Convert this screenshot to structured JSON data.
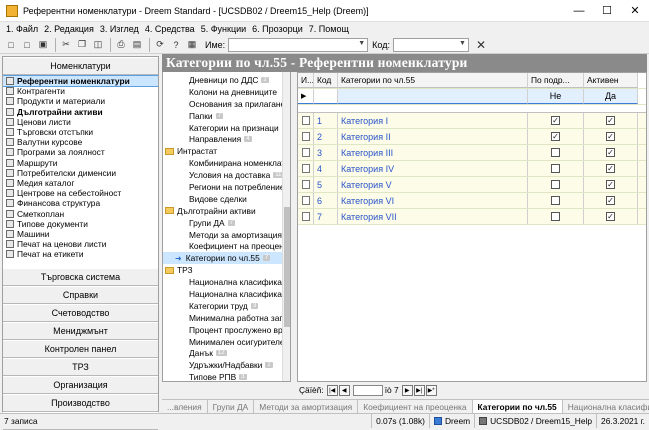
{
  "window": {
    "title": "Референтни номенклатури - Dreem Standard - [UCSDB02 / Dreem15_Help (Dreem)]"
  },
  "menu": [
    "1. Файл",
    "2. Редакция",
    "3. Изглед",
    "4. Средства",
    "5. Функции",
    "6. Прозорци",
    "7. Помощ"
  ],
  "toolbar": {
    "name_label": "Име:",
    "code_label": "Код:",
    "name_value": "",
    "code_value": ""
  },
  "left_nav": {
    "top_button": "Номенклатури",
    "items": [
      {
        "label": "Референтни номенклатури",
        "selected": true,
        "bold": true
      },
      {
        "label": "Контрагенти"
      },
      {
        "label": "Продукти и материали"
      },
      {
        "label": "Дълготрайни активи",
        "bold": true
      },
      {
        "label": "Ценови листи"
      },
      {
        "label": "Търговски отстъпки"
      },
      {
        "label": "Валутни курсове"
      },
      {
        "label": "Програми за лоялност"
      },
      {
        "label": "Маршрути"
      },
      {
        "label": "Потребителски дименсии"
      },
      {
        "label": "Медия каталог"
      },
      {
        "label": "Центрове на себестойност"
      },
      {
        "label": "Финансова структура"
      },
      {
        "label": "Сметкоплан"
      },
      {
        "label": "Типове документи"
      },
      {
        "label": "Машини"
      },
      {
        "label": "Печат на ценови листи"
      },
      {
        "label": "Печат на етикети"
      }
    ],
    "bottom_buttons": [
      "Търговска система",
      "Справки",
      "Счетоводство",
      "Мениджмънт",
      "Контролен панел",
      "ТРЗ",
      "Организация",
      "Производство",
      "Администрация"
    ]
  },
  "middle_tree": [
    {
      "label": "Дневници по ДДС",
      "count": "2",
      "indent": 1
    },
    {
      "label": "Колони на дневниците",
      "count": "",
      "indent": 1
    },
    {
      "label": "Основания за прилагане",
      "count": "",
      "indent": 1
    },
    {
      "label": "Папки",
      "count": "7",
      "indent": 1
    },
    {
      "label": "Категории на признаци",
      "count": "",
      "indent": 1
    },
    {
      "label": "Направления",
      "count": "4",
      "indent": 1
    },
    {
      "label": "Интрастат",
      "count": "",
      "indent": 0,
      "folder": true
    },
    {
      "label": "Комбинирана номенклатура",
      "count": "",
      "indent": 1
    },
    {
      "label": "Условия на доставка",
      "count": "11",
      "indent": 1
    },
    {
      "label": "Региони на потреблението",
      "count": "",
      "indent": 1
    },
    {
      "label": "Видове сделки",
      "count": "",
      "indent": 1
    },
    {
      "label": "Дълготрайни активи",
      "count": "",
      "indent": 0,
      "folder": true
    },
    {
      "label": "Групи ДА",
      "count": "7",
      "indent": 1
    },
    {
      "label": "Методи за амортизация",
      "count": "",
      "indent": 1
    },
    {
      "label": "Коефициент на преоценка",
      "count": "",
      "indent": 1
    },
    {
      "label": "Категории по чл.55",
      "count": "7",
      "indent": 1,
      "selected": true
    },
    {
      "label": "ТРЗ",
      "count": "",
      "indent": 0,
      "folder": true
    },
    {
      "label": "Национална класификация",
      "count": "",
      "indent": 1
    },
    {
      "label": "Национална класификация",
      "count": "",
      "indent": 1
    },
    {
      "label": "Категории труд",
      "count": "3",
      "indent": 1
    },
    {
      "label": "Минимална работна заплата",
      "count": "",
      "indent": 1
    },
    {
      "label": "Процент прослужено време",
      "count": "",
      "indent": 1
    },
    {
      "label": "Минимален осигурителен",
      "count": "",
      "indent": 1
    },
    {
      "label": "Данък",
      "count": "12",
      "indent": 1
    },
    {
      "label": "Удръжки/Надбавки",
      "count": "2",
      "indent": 1
    },
    {
      "label": "Типове РПВ",
      "count": "3",
      "indent": 1
    }
  ],
  "header": {
    "title": "Категории по чл.55 - Референтни номенклатури"
  },
  "grid": {
    "columns": [
      "И...",
      "Код",
      "Категории по чл.55",
      "По подр...",
      "Активен"
    ],
    "filter": {
      "default": "Не",
      "active": "Да"
    },
    "rows": [
      {
        "code": "1",
        "name": "Категория I",
        "default": true,
        "active": true
      },
      {
        "code": "2",
        "name": "Категория II",
        "default": true,
        "active": true
      },
      {
        "code": "3",
        "name": "Категория III",
        "default": false,
        "active": true
      },
      {
        "code": "4",
        "name": "Категория IV",
        "default": false,
        "active": true
      },
      {
        "code": "5",
        "name": "Категория V",
        "default": false,
        "active": true
      },
      {
        "code": "6",
        "name": "Категория VI",
        "default": false,
        "active": true
      },
      {
        "code": "7",
        "name": "Категория VII",
        "default": false,
        "active": true
      }
    ]
  },
  "pager": {
    "label": "Çäïèñ:",
    "current": "",
    "of_label": "ïò 7"
  },
  "tabs": [
    "...вления",
    "Групи ДА",
    "Методи за амортизация",
    "Коефициент на преоценка",
    "Категории по чл.55",
    "Национална класифика..."
  ],
  "active_tab": 4,
  "status": {
    "records": "7 записа",
    "timing": "0.07s (1.08k)",
    "app": "Dreem",
    "db": "UCSDB02 / Dreem15_Help",
    "date": "26.3.2021 г."
  }
}
